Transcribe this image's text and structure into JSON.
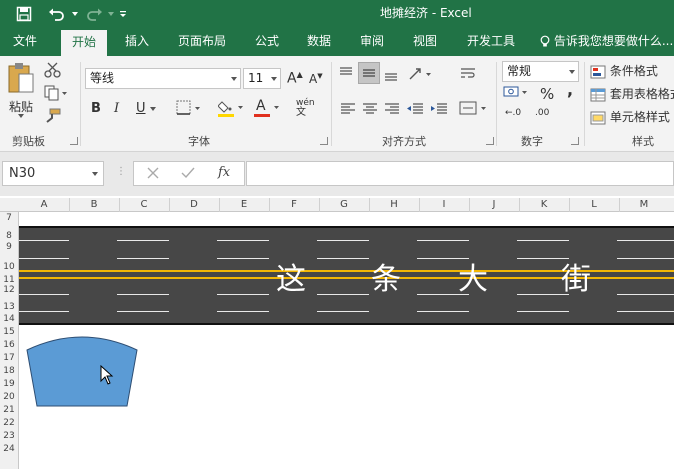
{
  "window": {
    "title": "地摊经济 - Excel"
  },
  "tabs": [
    {
      "label": "文件"
    },
    {
      "label": "开始"
    },
    {
      "label": "插入"
    },
    {
      "label": "页面布局"
    },
    {
      "label": "公式"
    },
    {
      "label": "数据"
    },
    {
      "label": "审阅"
    },
    {
      "label": "视图"
    },
    {
      "label": "开发工具"
    }
  ],
  "tell_me": {
    "placeholder": "告诉我您想要做什么..."
  },
  "ribbon": {
    "clipboard": {
      "paste": "粘贴",
      "label": "剪贴板"
    },
    "font": {
      "name": "等线",
      "size": "11",
      "bold": "B",
      "italic": "I",
      "underline": "U",
      "label": "字体",
      "grow": "A",
      "shrink": "A",
      "font_color_letter": "A",
      "phonetic": "wén"
    },
    "alignment": {
      "label": "对齐方式"
    },
    "number": {
      "format": "常规",
      "percent": "%",
      "comma": ",",
      "label": "数字",
      "inc_decimal": "←.0",
      "dec_decimal": ".00"
    },
    "styles": {
      "conditional": "条件格式",
      "table": "套用表格格式",
      "cell": "单元格样式",
      "label": "样式"
    }
  },
  "formula_bar": {
    "name_box": "N30",
    "fx": "fx",
    "content": ""
  },
  "columns": [
    "A",
    "B",
    "C",
    "D",
    "E",
    "F",
    "G",
    "H",
    "I",
    "J",
    "K",
    "L",
    "M"
  ],
  "rows": [
    "7",
    "8",
    "9",
    "10",
    "11",
    "12",
    "13",
    "14",
    "15",
    "16",
    "17",
    "18",
    "19",
    "20",
    "21",
    "22",
    "23",
    "24"
  ],
  "road": {
    "chars": [
      "这",
      "条",
      "大",
      "街"
    ]
  },
  "colors": {
    "excel_green": "#217346",
    "road": "#474747",
    "center_line": "#f2b705",
    "shape_fill": "#5b9bd5"
  }
}
